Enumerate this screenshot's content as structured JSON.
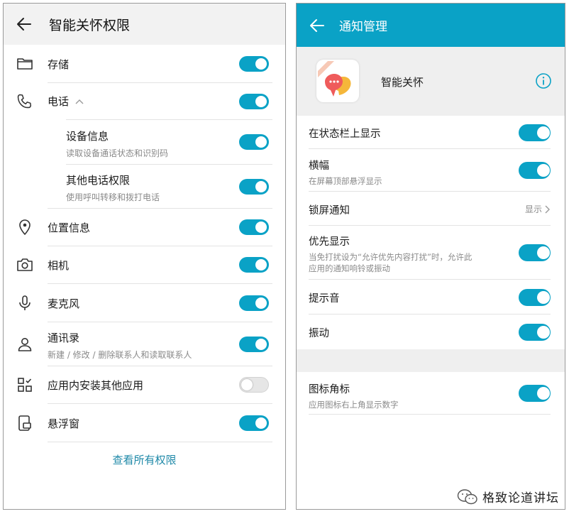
{
  "left": {
    "title": "智能关怀权限",
    "rows": [
      {
        "label": "存储",
        "desc": "",
        "on": true
      },
      {
        "label": "电话",
        "desc": "",
        "on": true
      },
      {
        "label": "设备信息",
        "desc": "读取设备通话状态和识别码",
        "on": true
      },
      {
        "label": "其他电话权限",
        "desc": "使用呼叫转移和拨打电话",
        "on": true
      },
      {
        "label": "位置信息",
        "desc": "",
        "on": true
      },
      {
        "label": "相机",
        "desc": "",
        "on": true
      },
      {
        "label": "麦克风",
        "desc": "",
        "on": true
      },
      {
        "label": "通讯录",
        "desc": "新建 / 修改 / 删除联系人和读取联系人",
        "on": true
      },
      {
        "label": "应用内安装其他应用",
        "desc": "",
        "on": false
      },
      {
        "label": "悬浮窗",
        "desc": "",
        "on": true
      }
    ],
    "view_all": "查看所有权限"
  },
  "right": {
    "title": "通知管理",
    "app_name": "智能关怀",
    "rows": [
      {
        "label": "在状态栏上显示",
        "desc": "",
        "on": true
      },
      {
        "label": "横幅",
        "desc": "在屏幕顶部悬浮显示",
        "on": true
      },
      {
        "label": "锁屏通知",
        "desc": "",
        "value": "显示"
      },
      {
        "label": "优先显示",
        "desc": "当免打扰设为“允许优先内容打扰”时，允许此",
        "desc2": "应用的通知响铃或振动",
        "on": true
      },
      {
        "label": "提示音",
        "desc": "",
        "on": true
      },
      {
        "label": "振动",
        "desc": "",
        "on": true
      },
      {
        "label": "图标角标",
        "desc": "应用图标右上角显示数字",
        "on": true
      }
    ]
  },
  "watermark": "格致论道讲坛",
  "colors": {
    "accent": "#0aa2c6",
    "link": "#1f89a8"
  }
}
